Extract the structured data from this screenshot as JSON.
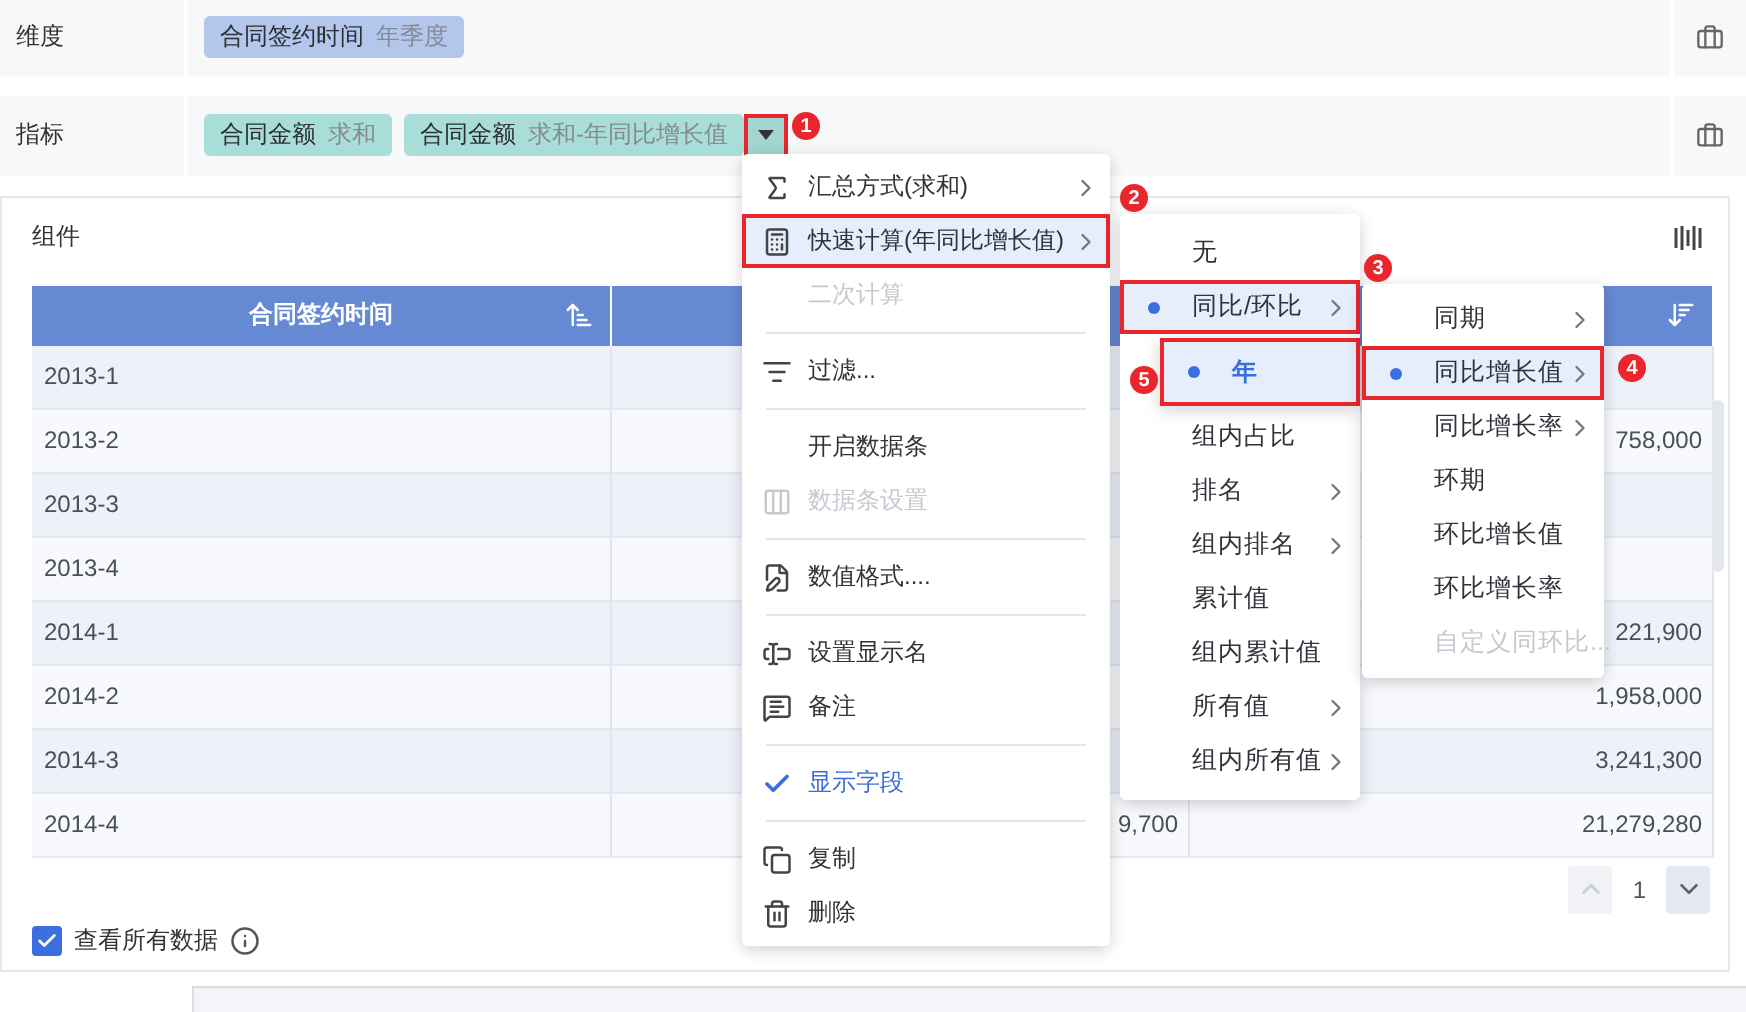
{
  "dimension_row": {
    "label": "维度",
    "chips": [
      {
        "name": "合同签约时间",
        "detail": "年季度",
        "dropdown": false
      }
    ]
  },
  "measure_row": {
    "label": "指标",
    "chips": [
      {
        "name": "合同金额",
        "detail": "求和",
        "dropdown": false
      },
      {
        "name": "合同金额",
        "detail": "求和-年同比增长值",
        "dropdown": true
      }
    ]
  },
  "panel": {
    "title": "组件",
    "table": {
      "header": "合同签约时间",
      "rows": [
        {
          "period": "2013-1"
        },
        {
          "period": "2013-2",
          "column_3": "758,000"
        },
        {
          "period": "2013-3"
        },
        {
          "period": "2013-4"
        },
        {
          "period": "2014-1",
          "column_3": "221,900"
        },
        {
          "period": "2014-2",
          "column_3": "1,958,000"
        },
        {
          "period": "2014-3",
          "column_3": "3,241,300"
        },
        {
          "period": "2014-4",
          "column_2": "9,700",
          "column_3": "21,279,280"
        }
      ]
    },
    "pagination": {
      "page": "1",
      "previous_disabled": true
    },
    "show_all": {
      "label": "查看所有数据",
      "checked": true
    }
  },
  "menu": {
    "items": [
      {
        "kind": "item",
        "label": "汇总方式(求和)",
        "disabled": false,
        "highlighted": false,
        "submenu": true,
        "checked": false
      },
      {
        "kind": "item",
        "label": "快速计算(年同比增长值)",
        "disabled": false,
        "highlighted": true,
        "submenu": true,
        "checked": false
      },
      {
        "kind": "item",
        "label": "二次计算",
        "disabled": true,
        "highlighted": false,
        "submenu": false,
        "checked": false
      },
      {
        "kind": "divider"
      },
      {
        "kind": "item",
        "label": "过滤...",
        "disabled": false,
        "highlighted": false,
        "submenu": false,
        "checked": false
      },
      {
        "kind": "divider"
      },
      {
        "kind": "item",
        "label": "开启数据条",
        "disabled": false,
        "highlighted": false,
        "submenu": false,
        "checked": false
      },
      {
        "kind": "item",
        "label": "数据条设置",
        "disabled": true,
        "highlighted": false,
        "submenu": false,
        "checked": false
      },
      {
        "kind": "divider"
      },
      {
        "kind": "item",
        "label": "数值格式....",
        "disabled": false,
        "highlighted": false,
        "submenu": false,
        "checked": false
      },
      {
        "kind": "divider"
      },
      {
        "kind": "item",
        "label": "设置显示名",
        "disabled": false,
        "highlighted": false,
        "submenu": false,
        "checked": false
      },
      {
        "kind": "item",
        "label": "备注",
        "disabled": false,
        "highlighted": false,
        "submenu": false,
        "checked": false
      },
      {
        "kind": "divider"
      },
      {
        "kind": "item",
        "label": "显示字段",
        "disabled": false,
        "highlighted": false,
        "submenu": false,
        "checked": true
      },
      {
        "kind": "divider"
      },
      {
        "kind": "item",
        "label": "复制",
        "disabled": false,
        "highlighted": false,
        "submenu": false,
        "checked": false
      },
      {
        "kind": "item",
        "label": "删除",
        "disabled": false,
        "highlighted": false,
        "submenu": false,
        "checked": false
      }
    ]
  },
  "quick_calc_menu": {
    "items": [
      {
        "label": "无",
        "selected": false,
        "highlighted": false,
        "submenu": false,
        "disabled": false
      },
      {
        "label": "同比/环比",
        "selected": true,
        "highlighted": true,
        "submenu": true,
        "disabled": false,
        "children": [
          {
            "label": "年",
            "selected": true,
            "highlighted": true
          }
        ]
      },
      {
        "label": "组内占比",
        "selected": false,
        "highlighted": false,
        "submenu": false,
        "disabled": false
      },
      {
        "label": "排名",
        "selected": false,
        "highlighted": false,
        "submenu": true,
        "disabled": false
      },
      {
        "label": "组内排名",
        "selected": false,
        "highlighted": false,
        "submenu": true,
        "disabled": false
      },
      {
        "label": "累计值",
        "selected": false,
        "highlighted": false,
        "submenu": false,
        "disabled": false
      },
      {
        "label": "组内累计值",
        "selected": false,
        "highlighted": false,
        "submenu": false,
        "disabled": false
      },
      {
        "label": "所有值",
        "selected": false,
        "highlighted": false,
        "submenu": true,
        "disabled": false
      },
      {
        "label": "组内所有值",
        "selected": false,
        "highlighted": false,
        "submenu": true,
        "disabled": false
      }
    ]
  },
  "yoy_menu": {
    "items": [
      {
        "label": "同期",
        "selected": false,
        "highlighted": false,
        "submenu": true,
        "disabled": false
      },
      {
        "label": "同比增长值",
        "selected": true,
        "highlighted": true,
        "submenu": true,
        "disabled": false
      },
      {
        "label": "同比增长率",
        "selected": false,
        "highlighted": false,
        "submenu": true,
        "disabled": false
      },
      {
        "label": "环期",
        "selected": false,
        "highlighted": false,
        "submenu": false,
        "disabled": false
      },
      {
        "label": "环比增长值",
        "selected": false,
        "highlighted": false,
        "submenu": false,
        "disabled": false
      },
      {
        "label": "环比增长率",
        "selected": false,
        "highlighted": false,
        "submenu": false,
        "disabled": false
      },
      {
        "label": "自定义同环比...",
        "selected": false,
        "highlighted": false,
        "submenu": false,
        "disabled": true
      }
    ]
  },
  "markers": [
    "1",
    "2",
    "3",
    "4",
    "5"
  ]
}
